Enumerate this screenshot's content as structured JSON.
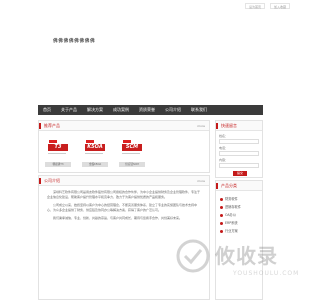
{
  "toplinks": [
    "设为首页",
    "加入收藏"
  ],
  "header": {
    "site_title": "佛佛佛佛佛佛佛佛"
  },
  "nav": [
    "首页",
    "关于产品",
    "解决方案",
    "成功案例",
    "资质荣誉",
    "公司介绍",
    "联系我们"
  ],
  "products": {
    "title": "推荐产品",
    "more": "more",
    "items": [
      {
        "name": "T3",
        "caption": "畅捷通T3"
      },
      {
        "name": "K5OA",
        "caption": "金蝶K5OA"
      },
      {
        "name": "SCM",
        "caption": "供应链SCM"
      }
    ]
  },
  "about": {
    "title": "公司介绍",
    "more": "more",
    "paragraphs": [
      "深圳科艺软件有限公司是用友软件股份有限公司授权的合作伙伴，为中小企业提供财务及企业管理软件，专注于企业信息化建设，帮助客户提升管理水平和竞争力，致力于为客户提供优质的产品和服务。",
      "公司成立以来，始终坚持以客户为中心的经营理念，不断完善服务体系，建立了专业的实施团队与技术支持中心，为众多企业提供了财务、供应链及协同办公等解决方案，获得了客户的广泛认可。",
      "我们秉承诚信、专业、创新、共赢的宗旨，与客户共同成长，期待与您携手合作，共创美好未来。"
    ]
  },
  "contact": {
    "title": "快速留言",
    "fields": [
      "姓名：",
      "电话：",
      "内容："
    ],
    "button": "提交"
  },
  "side_products": {
    "title": "产品分类",
    "items": [
      "财务软件",
      "进销存软件",
      "OA办公",
      "ERP系统",
      "行业方案"
    ]
  },
  "watermark": {
    "text": "攸收录",
    "sub": "YOUSHOULU.COM"
  },
  "colors": {
    "accent": "#c41a1a",
    "nav": "#3b3b3b"
  }
}
